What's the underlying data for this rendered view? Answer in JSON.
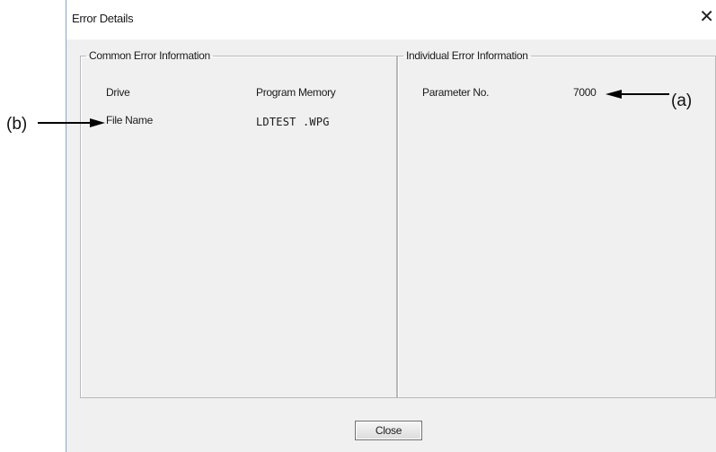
{
  "window": {
    "title": "Error Details",
    "close_glyph": "✕"
  },
  "common": {
    "legend": "Common Error Information",
    "drive_label": "Drive",
    "drive_value": "Program Memory",
    "file_label": "File Name",
    "file_value": "LDTEST .WPG"
  },
  "individual": {
    "legend": "Individual Error Information",
    "param_label": "Parameter No.",
    "param_value": "7000"
  },
  "footer": {
    "close_label": "Close"
  },
  "callouts": {
    "a": "(a)",
    "b": "(b)"
  }
}
